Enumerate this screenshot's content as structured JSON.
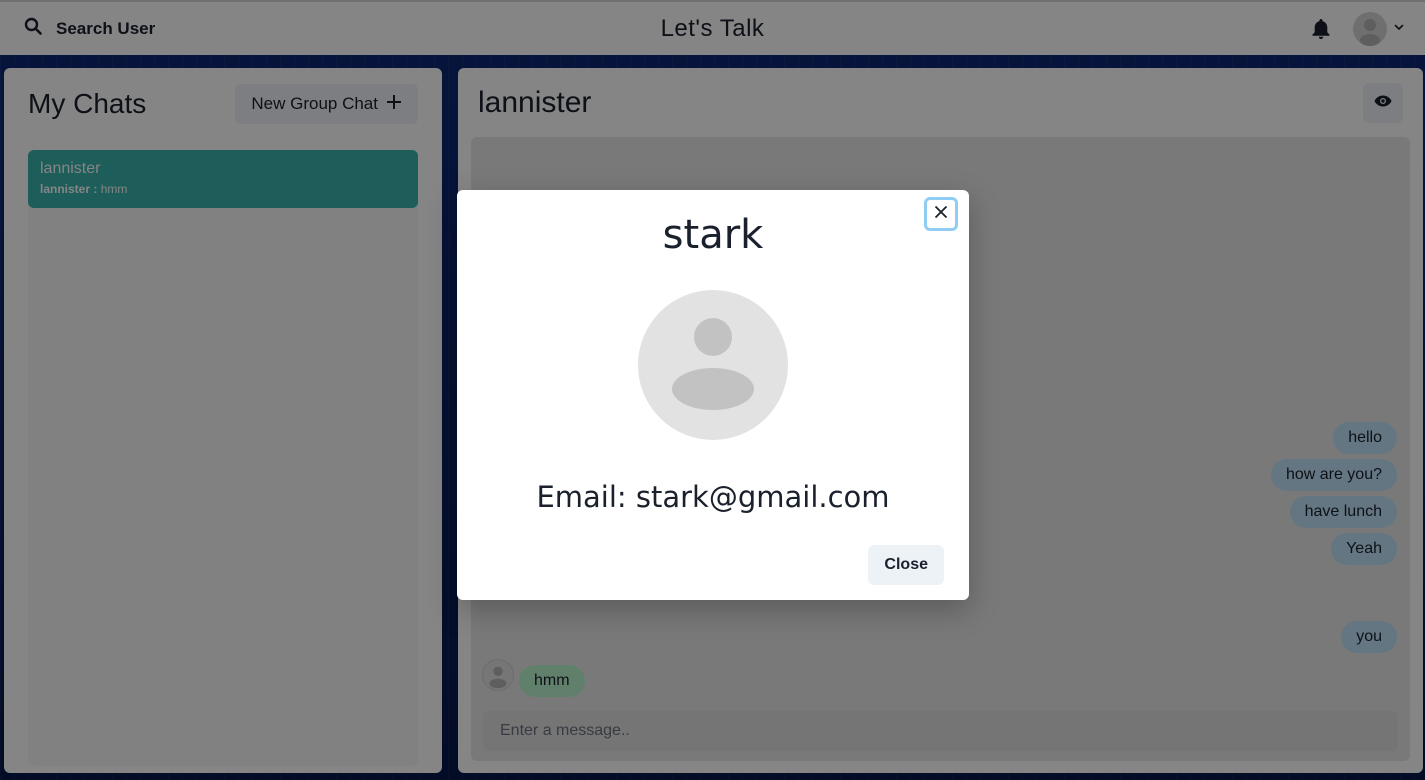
{
  "header": {
    "search_label": "Search User",
    "app_title": "Let's Talk"
  },
  "sidebar": {
    "title": "My Chats",
    "new_group_label": "New Group Chat",
    "chats": [
      {
        "name": "lannister",
        "sender": "lannister :",
        "preview": "hmm"
      }
    ]
  },
  "chat": {
    "name": "lannister",
    "messages": [
      {
        "text": "hello",
        "direction": "out"
      },
      {
        "text": "how are you?",
        "direction": "out"
      },
      {
        "text": "have lunch",
        "direction": "out"
      },
      {
        "text": "Yeah",
        "direction": "out"
      },
      {
        "text": "you",
        "direction": "out"
      },
      {
        "text": "hmm",
        "direction": "in"
      }
    ],
    "input_placeholder": "Enter a message.."
  },
  "modal": {
    "title": "stark",
    "email_line": "Email: stark@gmail.com",
    "close_label": "Close"
  },
  "colors": {
    "accent_teal": "#38b2ac",
    "bubble_out": "#bee3f8",
    "bubble_in": "#b9f5d0",
    "focus_ring": "#90cdf4"
  }
}
